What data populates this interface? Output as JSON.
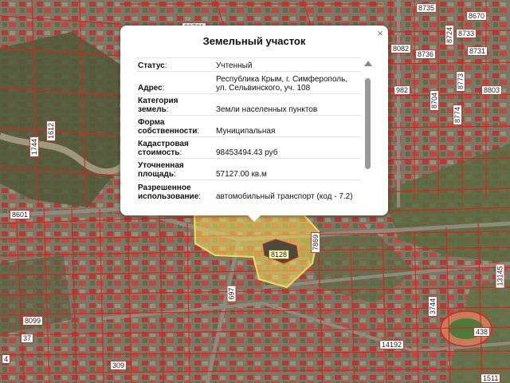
{
  "popup": {
    "title": "Земельный участок",
    "close_glyph": "×",
    "attributes": [
      {
        "key": "Статус",
        "value": "Учтенный"
      },
      {
        "key": "Адрес",
        "value": "Республика Крым, г. Симферополь, ул. Сельвинского, уч. 108"
      },
      {
        "key": "Категория земель",
        "value": "Земли населенных пунктов"
      },
      {
        "key": "Форма собственности",
        "value": "Муниципальная"
      },
      {
        "key": "Кадастровая стоимость",
        "value": "98453494.43 руб"
      },
      {
        "key": "Уточненная площадь",
        "value": "57127.00 кв.м"
      },
      {
        "key": "Разрешенное использование",
        "value": "автомобильный транспорт (код - 7.2)"
      }
    ]
  },
  "map": {
    "parcel_outline_color": "#e0201b",
    "selected_parcel_fill": "#f3dc5a",
    "parcel_labels": [
      "20761",
      "8735",
      "8670",
      "8733",
      "8724",
      "8082",
      "8736",
      "8731",
      "982",
      "8704",
      "8773",
      "8803",
      "8774",
      "1612",
      "1744",
      "8601",
      "8128",
      "7869",
      "697",
      "3744",
      "13145",
      "8099",
      "37",
      "309",
      "14192",
      "438",
      "1511",
      "4"
    ]
  }
}
